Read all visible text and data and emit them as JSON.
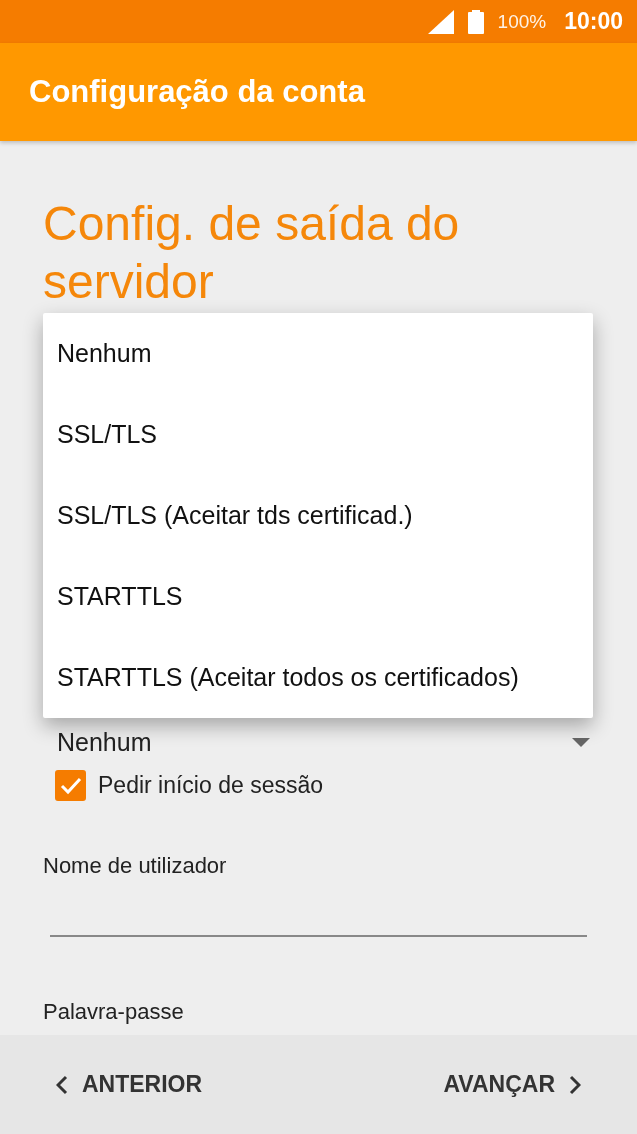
{
  "status_bar": {
    "battery": "100%",
    "time": "10:00"
  },
  "app_bar": {
    "title": "Configuração da conta"
  },
  "heading": "Config. de saída do servidor",
  "security_spinner": {
    "value": "Nenhum"
  },
  "login_checkbox": {
    "label": "Pedir início de sessão",
    "checked": true
  },
  "username": {
    "label": "Nome de utilizador"
  },
  "password": {
    "label": "Palavra-passe"
  },
  "dropdown": {
    "options": [
      {
        "label": "Nenhum",
        "selected": false
      },
      {
        "label": "SSL/TLS",
        "selected": false
      },
      {
        "label": "SSL/TLS (Aceitar tds certificad.)",
        "selected": false
      },
      {
        "label": "STARTTLS",
        "selected": false
      },
      {
        "label": "STARTTLS (Aceitar todos os certificados)",
        "selected": false
      }
    ]
  },
  "nav": {
    "back": "ANTERIOR",
    "next": "AVANÇAR"
  }
}
